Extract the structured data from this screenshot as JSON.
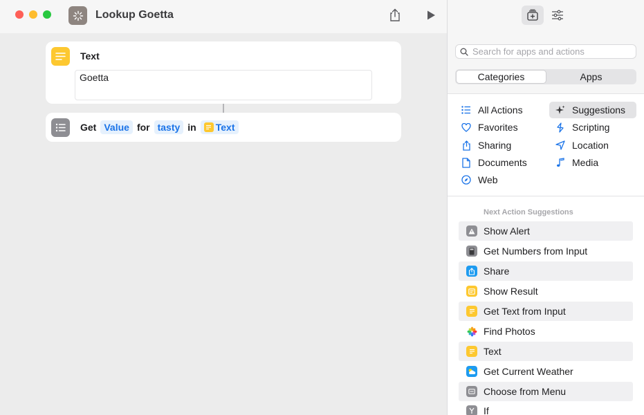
{
  "window": {
    "title": "Lookup Goetta"
  },
  "editor": {
    "text_action": {
      "title": "Text",
      "content": "Goetta"
    },
    "get_action": {
      "verb": "Get",
      "value_token": "Value",
      "for_word": "for",
      "key_token": "tasty",
      "in_word": "in",
      "source_token": "Text"
    }
  },
  "library": {
    "search_placeholder": "Search for apps and actions",
    "tabs": [
      "Categories",
      "Apps"
    ],
    "active_tab": "Categories",
    "categories": [
      {
        "label": "All Actions",
        "icon": "list-icon"
      },
      {
        "label": "Suggestions",
        "icon": "sparkle-icon",
        "selected": true
      },
      {
        "label": "Favorites",
        "icon": "heart-icon"
      },
      {
        "label": "Scripting",
        "icon": "scripting-icon"
      },
      {
        "label": "Sharing",
        "icon": "share-icon"
      },
      {
        "label": "Location",
        "icon": "location-arrow-icon"
      },
      {
        "label": "Documents",
        "icon": "document-icon"
      },
      {
        "label": "Media",
        "icon": "music-note-icon"
      },
      {
        "label": "Web",
        "icon": "compass-icon"
      }
    ],
    "suggestions_header": "Next Action Suggestions",
    "suggestions": [
      {
        "label": "Show Alert",
        "icon": "alert-icon",
        "color": "#8e8e93"
      },
      {
        "label": "Get Numbers from Input",
        "icon": "calculator-icon",
        "color": "#8e8e93"
      },
      {
        "label": "Share",
        "icon": "share-icon",
        "color": "#1e9bf0"
      },
      {
        "label": "Show Result",
        "icon": "show-result-icon",
        "color": "#fdc830"
      },
      {
        "label": "Get Text from Input",
        "icon": "text-icon",
        "color": "#fdc830"
      },
      {
        "label": "Find Photos",
        "icon": "photos-icon",
        "color": "#f5a623"
      },
      {
        "label": "Text",
        "icon": "text-icon",
        "color": "#fdc830"
      },
      {
        "label": "Get Current Weather",
        "icon": "weather-icon",
        "color": "#1e9bf0"
      },
      {
        "label": "Choose from Menu",
        "icon": "menu-icon",
        "color": "#8e8e93"
      },
      {
        "label": "If",
        "icon": "if-icon",
        "color": "#8e8e93"
      }
    ]
  }
}
